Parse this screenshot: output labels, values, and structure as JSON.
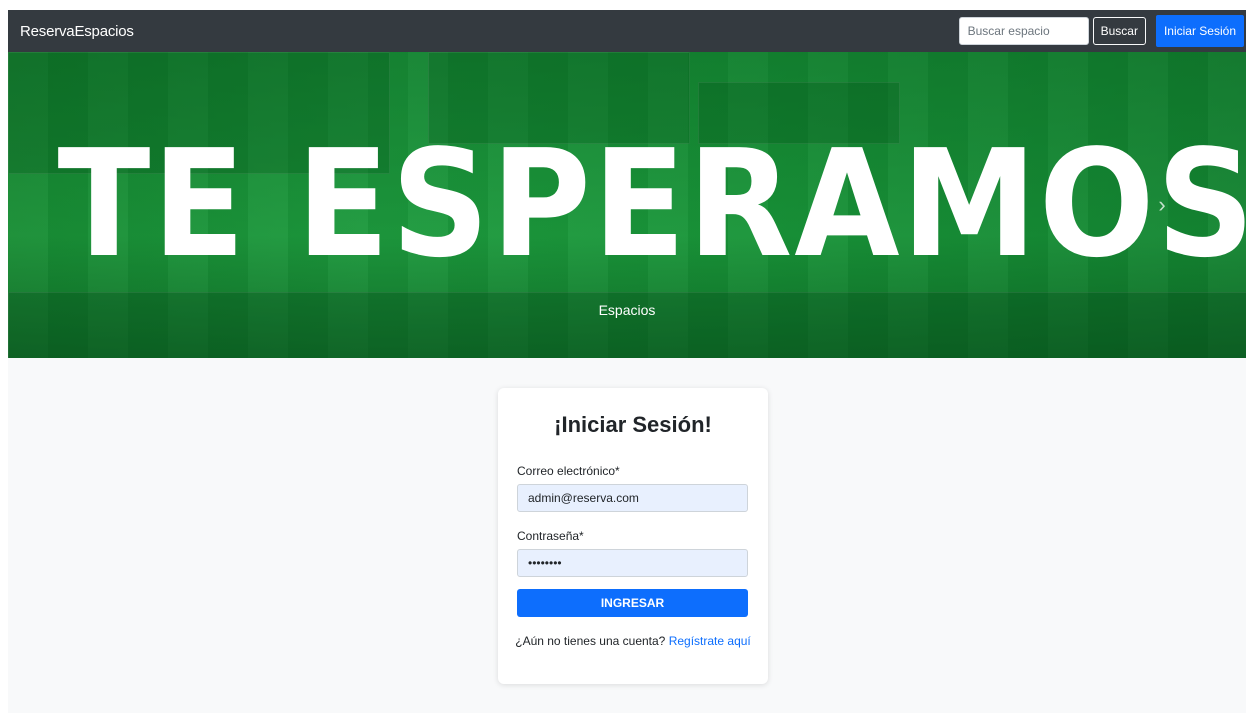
{
  "navbar": {
    "brand": "ReservaEspacios",
    "search_placeholder": "Buscar espacio",
    "search_button": "Buscar",
    "login_button": "Iniciar Sesión"
  },
  "hero": {
    "title": "TE ESPERAMOS",
    "caption": "Espacios",
    "prev_arrow": "‹",
    "next_arrow": "›"
  },
  "login_card": {
    "title": "¡Iniciar Sesión!",
    "email_label": "Correo electrónico*",
    "email_value": "admin@reserva.com",
    "password_label": "Contraseña*",
    "password_value": "12345678",
    "submit_label": "INGRESAR",
    "register_prompt": "¿Aún no tienes una cuenta?",
    "register_link": "Regístrate aquí"
  },
  "colors": {
    "navbar_bg": "#343a40",
    "primary": "#0d6efd",
    "hero_green": "#1a8f36",
    "content_bg": "#f8f9fa",
    "input_autofill_bg": "#e8f0fe"
  }
}
